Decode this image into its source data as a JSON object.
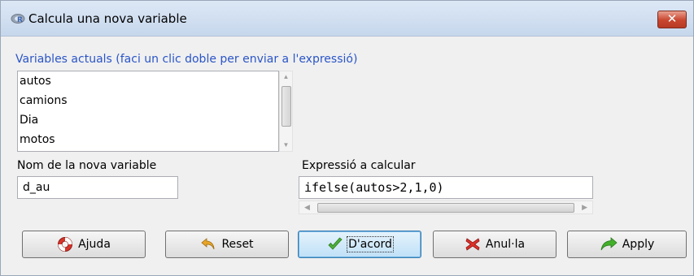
{
  "window": {
    "title": "Calcula una nova variable",
    "close_label": "✕"
  },
  "variables": {
    "label": "Variables actuals (faci un clic doble per enviar a l'expressió)",
    "items": [
      "autos",
      "camions",
      "Dia",
      "motos"
    ]
  },
  "name_field": {
    "label": "Nom de la nova variable",
    "value": "d_au"
  },
  "expression_field": {
    "label": "Expressió a calcular",
    "value": "ifelse(autos>2,1,0)"
  },
  "buttons": {
    "help": "Ajuda",
    "reset": "Reset",
    "ok": "D'acord",
    "cancel": "Anul·la",
    "apply": "Apply"
  },
  "icons": {
    "title": "r-logo-icon",
    "help": "lifebuoy-icon",
    "reset": "undo-arrow-icon",
    "ok": "checkmark-icon",
    "cancel": "red-x-icon",
    "apply": "green-arrow-icon"
  },
  "colors": {
    "label_blue": "#2a55c8",
    "close_red": "#c8452e",
    "default_button": "#bfe0f7"
  }
}
